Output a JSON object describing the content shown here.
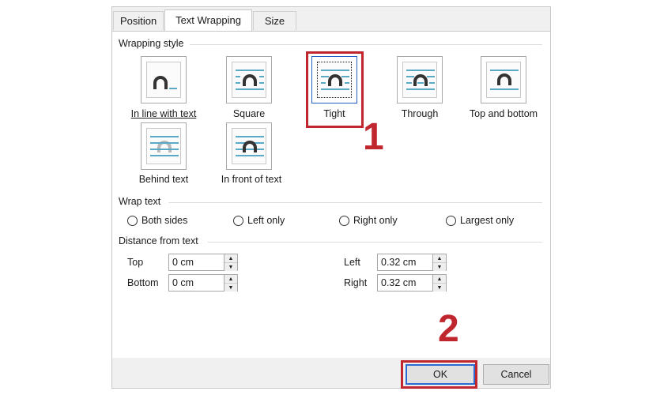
{
  "tabs": [
    "Position",
    "Text Wrapping",
    "Size"
  ],
  "wrapping_style": {
    "group_label": "Wrapping style",
    "options": [
      {
        "label": "In line with text",
        "icon": "inline-with-text-icon"
      },
      {
        "label": "Square",
        "icon": "square-wrap-icon"
      },
      {
        "label": "Tight",
        "icon": "tight-wrap-icon",
        "selected": true
      },
      {
        "label": "Through",
        "icon": "through-wrap-icon"
      },
      {
        "label": "Top and bottom",
        "icon": "top-bottom-wrap-icon"
      },
      {
        "label": "Behind text",
        "icon": "behind-text-icon"
      },
      {
        "label": "In front of text",
        "icon": "in-front-of-text-icon"
      }
    ]
  },
  "wrap_text": {
    "group_label": "Wrap text",
    "options": [
      "Both sides",
      "Left only",
      "Right only",
      "Largest only"
    ]
  },
  "distance": {
    "group_label": "Distance from text",
    "top": {
      "label": "Top",
      "value": "0 cm"
    },
    "bottom": {
      "label": "Bottom",
      "value": "0 cm"
    },
    "left": {
      "label": "Left",
      "value": "0.32 cm"
    },
    "right": {
      "label": "Right",
      "value": "0.32 cm"
    }
  },
  "buttons": {
    "ok": "OK",
    "cancel": "Cancel"
  },
  "annotations": {
    "step1": "1",
    "step2": "2",
    "color": "#c0262d"
  },
  "colors": {
    "icon_lines": "#5aa9c9",
    "icon_arch": "#333333",
    "selection_blue": "#1e5fbf"
  }
}
